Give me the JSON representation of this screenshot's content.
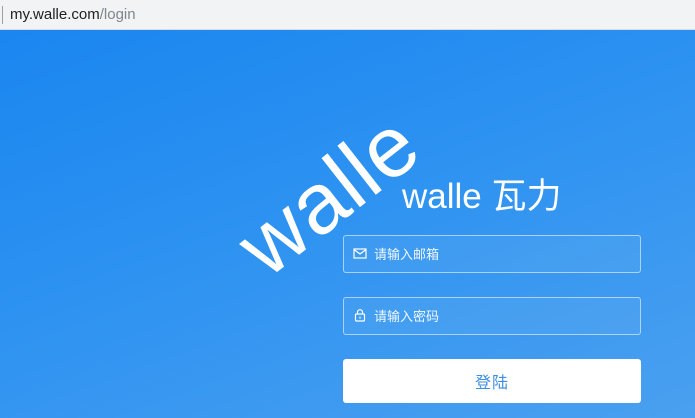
{
  "browser": {
    "url_host": "my.walle.com",
    "url_path": "/login"
  },
  "login": {
    "logo_text": "walle",
    "title": "walle 瓦力",
    "email_placeholder": "请输入邮箱",
    "password_placeholder": "请输入密码",
    "submit_label": "登陆"
  },
  "icons": {
    "email": "mail-icon",
    "password": "lock-icon"
  },
  "colors": {
    "background_start": "#1a86f0",
    "background_end": "#4aa0f0",
    "button_text": "#3d8fe0",
    "text": "#ffffff"
  }
}
